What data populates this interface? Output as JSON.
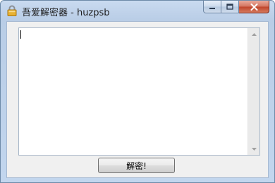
{
  "window": {
    "title": "吾爱解密器 - huzpsb",
    "controls": {
      "minimize_icon": "minimize-icon",
      "maximize_icon": "maximize-icon",
      "close_icon": "close-icon"
    }
  },
  "main": {
    "text_value": "",
    "decrypt_button_label": "解密!"
  },
  "colors": {
    "title_bar": "#c5d8ef",
    "client_bg": "#f0f0f0",
    "close_button": "#c7452d"
  }
}
